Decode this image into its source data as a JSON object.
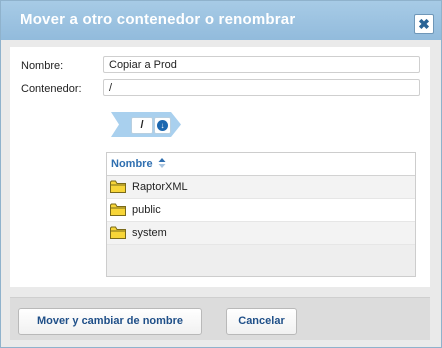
{
  "dialog": {
    "title": "Mover a otro contenedor o renombrar",
    "close_icon": "close-icon"
  },
  "form": {
    "name_label": "Nombre:",
    "name_value": "Copiar a Prod",
    "container_label": "Contenedor:",
    "container_value": "/"
  },
  "breadcrumb": {
    "segment": "/",
    "dropdown_icon": "arrow-down-circle-icon"
  },
  "list": {
    "column_header": "Nombre",
    "sort_icon": "sort-ascending-icon",
    "items": [
      {
        "label": "RaptorXML",
        "icon": "folder-icon"
      },
      {
        "label": "public",
        "icon": "folder-icon"
      },
      {
        "label": "system",
        "icon": "folder-icon"
      }
    ]
  },
  "footer": {
    "move_rename_label": "Mover y cambiar de nombre",
    "cancel_label": "Cancelar"
  },
  "colors": {
    "title_bar": "#a0c6e3",
    "accent_text": "#2f6fb0",
    "folder": "#f7d538",
    "button_text": "#1f4f88"
  }
}
